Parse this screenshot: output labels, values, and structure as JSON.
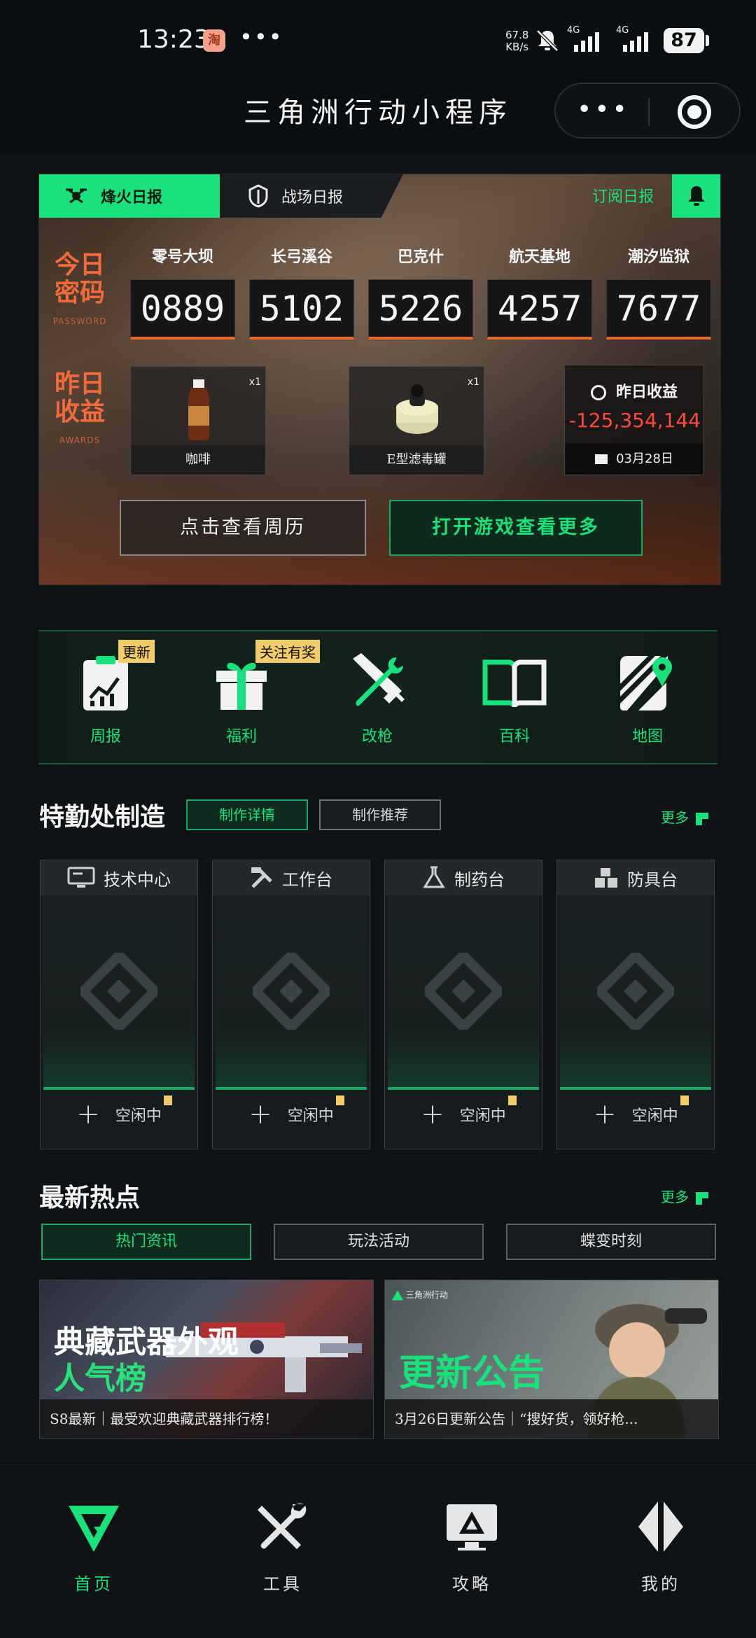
{
  "status": {
    "time": "13:23",
    "app_badge": "淘",
    "dots": "•••",
    "net_speed_value": "67.8",
    "net_speed_unit": "KB/s",
    "net1": "4G",
    "net2": "4G",
    "battery": "87"
  },
  "nav": {
    "title": "三角洲行动小程序",
    "more": "•••"
  },
  "banner": {
    "tab_fire": "烽火日报",
    "tab_battle": "战场日报",
    "subscribe": "订阅日报",
    "today_code_title_1": "今日",
    "today_code_title_2": "密码",
    "today_code_sub": "PASSWORD",
    "yesterday_title_1": "昨日",
    "yesterday_title_2": "收益",
    "yesterday_sub": "AWARDS",
    "maps": [
      "零号大坝",
      "长弓溪谷",
      "巴克什",
      "航天基地",
      "潮汐监狱"
    ],
    "codes": [
      "0889",
      "5102",
      "5226",
      "4257",
      "7677"
    ],
    "items": [
      {
        "name": "咖啡",
        "qty": "x1"
      },
      {
        "name": "E型滤毒罐",
        "qty": "x1"
      }
    ],
    "earn_title": "昨日收益",
    "earn_value": "-125,354,144",
    "earn_date": "03月28日",
    "btn_week": "点击查看周历",
    "btn_open": "打开游戏查看更多"
  },
  "tools": [
    {
      "label": "周报",
      "tag": "更新"
    },
    {
      "label": "福利",
      "tag": "关注有奖"
    },
    {
      "label": "改枪",
      "tag": ""
    },
    {
      "label": "百科",
      "tag": ""
    },
    {
      "label": "地图",
      "tag": ""
    }
  ],
  "craft": {
    "title": "特勤处制造",
    "chip_detail": "制作详情",
    "chip_recommend": "制作推荐",
    "more": "更多",
    "stations": [
      {
        "name": "技术中心",
        "status": "空闲中"
      },
      {
        "name": "工作台",
        "status": "空闲中"
      },
      {
        "name": "制药台",
        "status": "空闲中"
      },
      {
        "name": "防具台",
        "status": "空闲中"
      }
    ]
  },
  "news": {
    "title": "最新热点",
    "more": "更多",
    "tabs": [
      "热门资讯",
      "玩法活动",
      "蝶变时刻"
    ],
    "cards": [
      {
        "big1": "典藏武器外观",
        "big2": "人气榜",
        "caption": "S8最新｜最受欢迎典藏武器排行榜！"
      },
      {
        "big1": "更新公告",
        "logo": "三角洲行动",
        "caption": "3月26日更新公告｜“搜好货，领好枪..."
      }
    ]
  },
  "bottom": [
    {
      "label": "首页",
      "active": true
    },
    {
      "label": "工具",
      "active": false
    },
    {
      "label": "攻略",
      "active": false
    },
    {
      "label": "我的",
      "active": false
    }
  ],
  "colors": {
    "accent": "#19e27d",
    "alert_red": "#ff4a3d",
    "tag_yellow": "#f3cc6a"
  }
}
